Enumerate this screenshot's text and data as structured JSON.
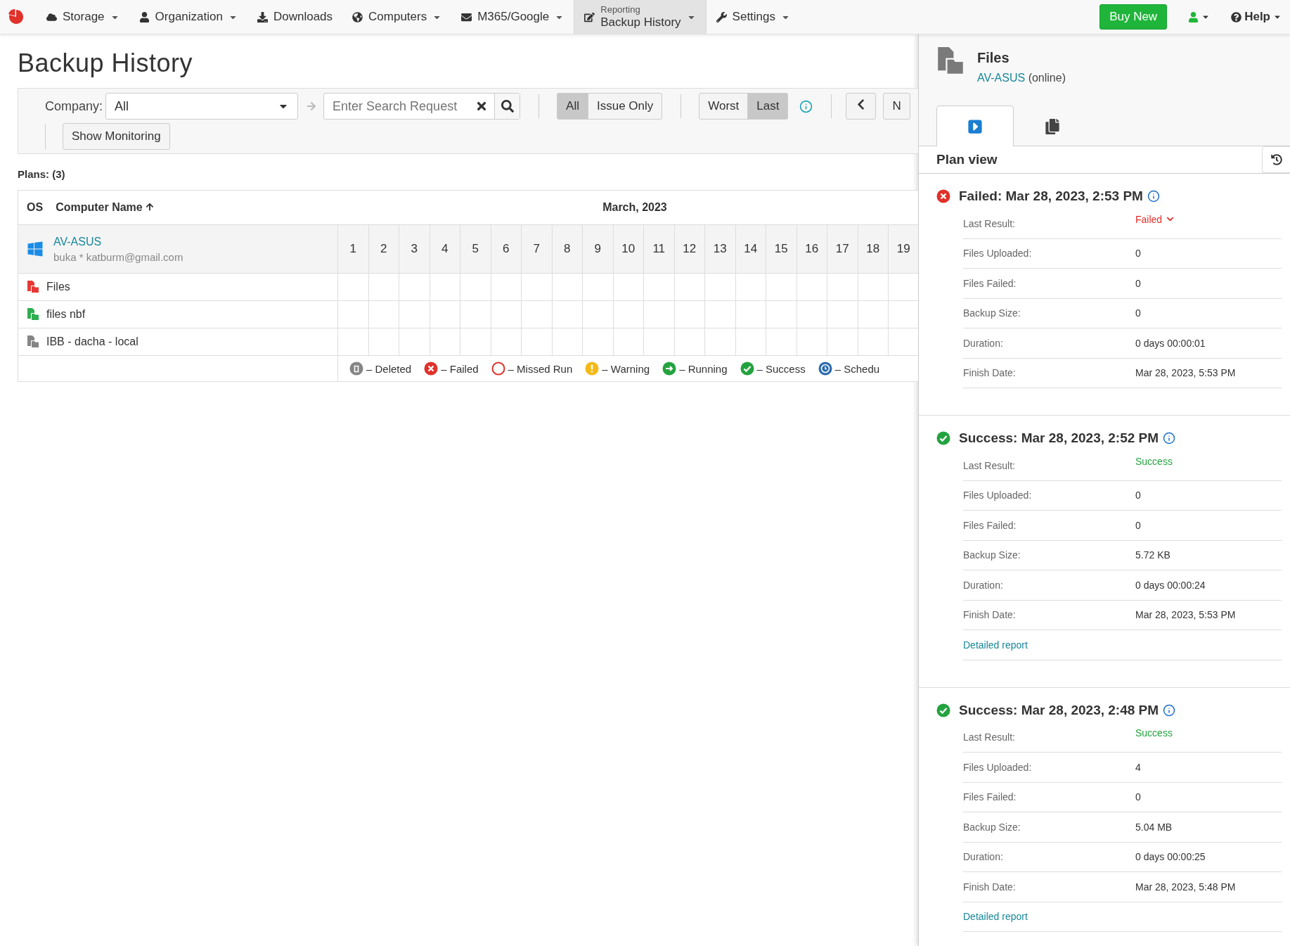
{
  "nav": {
    "items": [
      {
        "label": "Storage",
        "dropdown": true,
        "selected": false
      },
      {
        "label": "Organization",
        "dropdown": true,
        "selected": false
      },
      {
        "label": "Downloads",
        "dropdown": false,
        "selected": false
      },
      {
        "label": "Computers",
        "dropdown": true,
        "selected": false
      },
      {
        "label": "M365/Google",
        "dropdown": true,
        "selected": false
      },
      {
        "overline": "Reporting",
        "label": "Backup History",
        "dropdown": true,
        "selected": true
      },
      {
        "label": "Settings",
        "dropdown": true,
        "selected": false
      }
    ],
    "buy_button": "Buy New",
    "help": "Help"
  },
  "page_title": "Backup History",
  "toolbar": {
    "company_label": "Company:",
    "company_value": "All",
    "search_placeholder": "Enter Search Request",
    "filters": [
      {
        "label": "All",
        "selected": true
      },
      {
        "label": "Issue Only",
        "selected": false
      }
    ],
    "modes": [
      {
        "label": "Worst",
        "selected": false
      },
      {
        "label": "Last",
        "selected": true
      }
    ],
    "next_button": "N",
    "monitoring_button": "Show Monitoring"
  },
  "plans_count": "Plans: (3)",
  "table": {
    "columns": [
      "OS",
      "Computer Name"
    ],
    "month": "March, 2023",
    "computer": {
      "name": "AV-ASUS",
      "subtitle": "buka * katburm@gmail.com"
    },
    "days": [
      "1",
      "2",
      "3",
      "4",
      "5",
      "6",
      "7",
      "8",
      "9",
      "10",
      "11",
      "12",
      "13",
      "14",
      "15",
      "16",
      "17",
      "18",
      "19"
    ],
    "plans": [
      {
        "name": "Files",
        "color": "#e53935"
      },
      {
        "name": "files nbf",
        "color": "#2eae4f"
      },
      {
        "name": "IBB - dacha - local",
        "color": "#858585"
      }
    ],
    "legend": [
      {
        "kind": "deleted",
        "label": "– Deleted"
      },
      {
        "kind": "failed",
        "label": "– Failed"
      },
      {
        "kind": "missed",
        "label": "– Missed Run"
      },
      {
        "kind": "warning",
        "label": "– Warning"
      },
      {
        "kind": "running",
        "label": "– Running"
      },
      {
        "kind": "success",
        "label": "– Success"
      },
      {
        "kind": "scheduled",
        "label": "– Schedu"
      }
    ]
  },
  "panel": {
    "title": "Files",
    "computer": "AV-ASUS",
    "computer_status": "(online)",
    "tabs": [
      {
        "kind": "plan",
        "selected": true
      },
      {
        "kind": "copies",
        "selected": false
      }
    ],
    "view_title": "Plan view",
    "results": [
      {
        "kind": "failed",
        "title": "Failed: Mar 28, 2023, 2:53 PM",
        "rows": [
          {
            "label": "Last Result:",
            "value": "Failed",
            "kind": "status"
          },
          {
            "label": "Files Uploaded:",
            "value": "0",
            "kind": "text"
          },
          {
            "label": "Files Failed:",
            "value": "0",
            "kind": "text"
          },
          {
            "label": "Backup Size:",
            "value": "0",
            "kind": "text"
          },
          {
            "label": "Duration:",
            "value": "0 days 00:00:01",
            "kind": "text"
          },
          {
            "label": "Finish Date:",
            "value": "Mar 28, 2023, 5:53 PM",
            "kind": "text"
          }
        ]
      },
      {
        "kind": "success",
        "title": "Success: Mar 28, 2023, 2:52 PM",
        "rows": [
          {
            "label": "Last Result:",
            "value": "Success",
            "kind": "status"
          },
          {
            "label": "Files Uploaded:",
            "value": "0",
            "kind": "text"
          },
          {
            "label": "Files Failed:",
            "value": "0",
            "kind": "text"
          },
          {
            "label": "Backup Size:",
            "value": "5.72 KB",
            "kind": "text"
          },
          {
            "label": "Duration:",
            "value": "0 days 00:00:24",
            "kind": "text"
          },
          {
            "label": "Finish Date:",
            "value": "Mar 28, 2023, 5:53 PM",
            "kind": "text"
          }
        ],
        "report_link": "Detailed report"
      },
      {
        "kind": "success",
        "title": "Success: Mar 28, 2023, 2:48 PM",
        "rows": [
          {
            "label": "Last Result:",
            "value": "Success",
            "kind": "status"
          },
          {
            "label": "Files Uploaded:",
            "value": "4",
            "kind": "text"
          },
          {
            "label": "Files Failed:",
            "value": "0",
            "kind": "text"
          },
          {
            "label": "Backup Size:",
            "value": "5.04 MB",
            "kind": "text"
          },
          {
            "label": "Duration:",
            "value": "0 days 00:00:25",
            "kind": "text"
          },
          {
            "label": "Finish Date:",
            "value": "Mar 28, 2023, 5:48 PM",
            "kind": "text"
          }
        ],
        "report_link": "Detailed report"
      }
    ]
  }
}
